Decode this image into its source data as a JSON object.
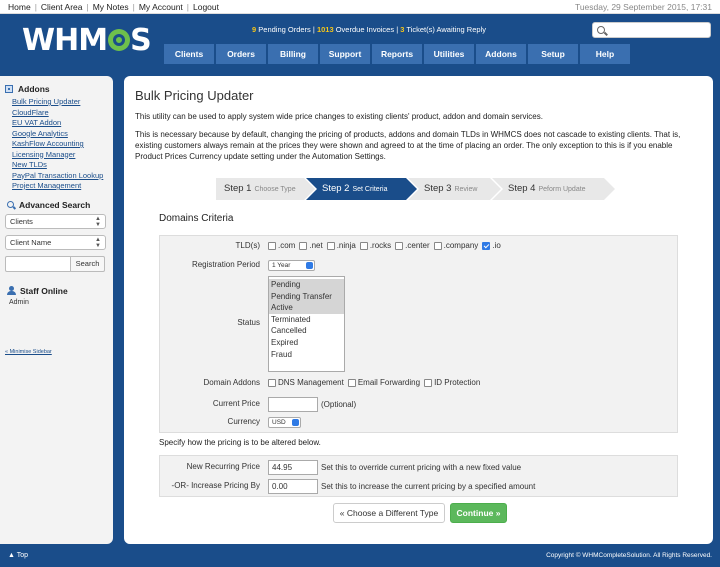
{
  "topbar": {
    "links": [
      "Home",
      "Client Area",
      "My Notes",
      "My Account",
      "Logout"
    ],
    "date": "Tuesday, 29 September 2015, 17:31"
  },
  "header": {
    "logo": "WHMCS",
    "notices": {
      "pending_count": "9",
      "pending_label": "Pending Orders",
      "overdue_count": "1013",
      "overdue_label": "Overdue Invoices",
      "tickets_count": "3",
      "tickets_label": "Ticket(s) Awaiting Reply",
      "separator": "|"
    }
  },
  "nav": [
    "Clients",
    "Orders",
    "Billing",
    "Support",
    "Reports",
    "Utilities",
    "Addons",
    "Setup",
    "Help"
  ],
  "sidebar": {
    "addons_heading": "Addons",
    "addons_links": [
      "Bulk Pricing Updater",
      "CloudFlare",
      "EU VAT Addon",
      "Google Analytics",
      "KashFlow Accounting",
      "Licensing Manager",
      "New TLDs",
      "PayPal Transaction Lookup",
      "Project Management"
    ],
    "search_heading": "Advanced Search",
    "search_type": "Clients",
    "search_field": "Client Name",
    "search_button": "Search",
    "staff_heading": "Staff Online",
    "staff_name": "Admin",
    "minimise": "« Minimise Sidebar"
  },
  "main": {
    "title": "Bulk Pricing Updater",
    "intro": "This utility can be used to apply system wide price changes to existing clients' product, addon and domain services.",
    "explanation": "This is necessary because by default, changing the pricing of products, addons and domain TLDs in WHMCS does not cascade to existing clients. That is, existing customers always remain at the prices they were shown and agreed to at the time of placing an order. The only exception to this is if you enable Product Prices Currency update setting under the Automation Settings.",
    "steps": [
      {
        "label": "Step 1",
        "sub": "Choose Type"
      },
      {
        "label": "Step 2",
        "sub": "Set Criteria"
      },
      {
        "label": "Step 3",
        "sub": "Review"
      },
      {
        "label": "Step 4",
        "sub": "Peform Update"
      }
    ],
    "section_title": "Domains Criteria",
    "criteria": {
      "tld_label": "TLD(s)",
      "tlds": [
        {
          "name": ".com",
          "checked": false
        },
        {
          "name": ".net",
          "checked": false
        },
        {
          "name": ".ninja",
          "checked": false
        },
        {
          "name": ".rocks",
          "checked": false
        },
        {
          "name": ".center",
          "checked": false
        },
        {
          "name": ".company",
          "checked": false
        },
        {
          "name": ".io",
          "checked": true
        }
      ],
      "period_label": "Registration Period",
      "period_value": "1 Year",
      "status_label": "Status",
      "statuses": [
        {
          "name": "Pending",
          "selected": true
        },
        {
          "name": "Pending Transfer",
          "selected": true
        },
        {
          "name": "Active",
          "selected": true
        },
        {
          "name": "Terminated",
          "selected": false
        },
        {
          "name": "Cancelled",
          "selected": false
        },
        {
          "name": "Expired",
          "selected": false
        },
        {
          "name": "Fraud",
          "selected": false
        }
      ],
      "addons_label": "Domain Addons",
      "addons": [
        "DNS Management",
        "Email Forwarding",
        "ID Protection"
      ],
      "current_price_label": "Current Price",
      "current_price_value": "",
      "current_price_hint": "(Optional)",
      "currency_label": "Currency",
      "currency_value": "USD"
    },
    "specify": "Specify how the pricing is to be altered below.",
    "pricing": {
      "new_label": "New Recurring Price",
      "new_value": "44.95",
      "new_hint": "Set this to override current pricing with a new fixed value",
      "inc_label": "-OR- Increase Pricing By",
      "inc_value": "0.00",
      "inc_hint": "Set this to increase the current pricing by a specified amount"
    },
    "back_button": "« Choose a Different Type",
    "continue_button": "Continue »"
  },
  "footer": {
    "top_link": "Top",
    "copyright": "Copyright © WHMCompleteSolution. All Rights Reserved."
  }
}
